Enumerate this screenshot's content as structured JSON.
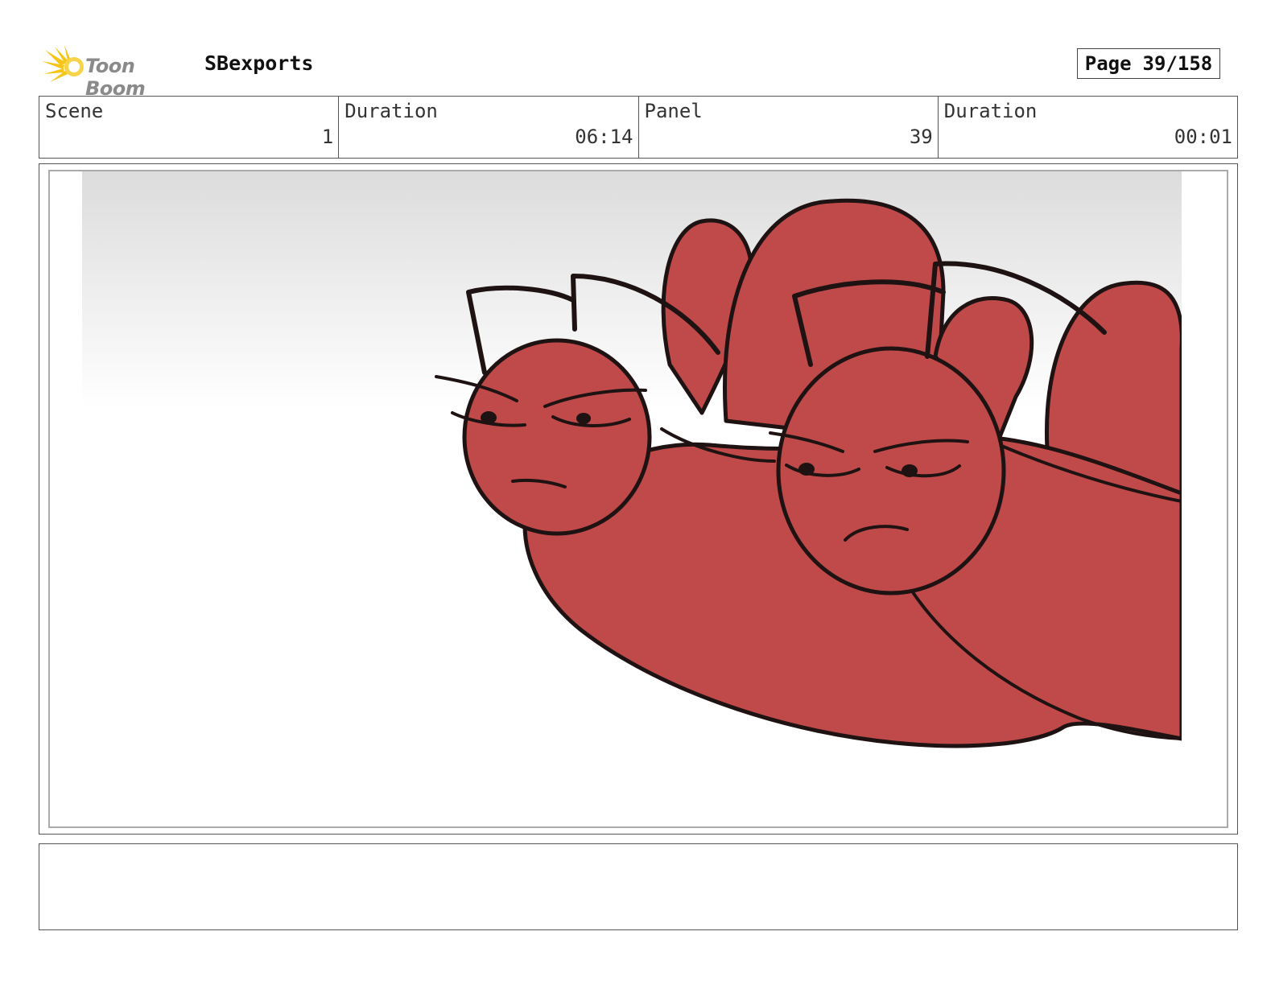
{
  "header": {
    "logo_text": "Toon Boom",
    "project_title": "SBexports",
    "page_label": "Page",
    "page_number": "39/158"
  },
  "info": {
    "scene_label": "Scene",
    "scene_value": "1",
    "scene_duration_label": "Duration",
    "scene_duration_value": "06:14",
    "panel_label": "Panel",
    "panel_value": "39",
    "panel_duration_label": "Duration",
    "panel_duration_value": "00:01"
  },
  "notes": {
    "text": ""
  },
  "colors": {
    "character_fill": "#c04a4a",
    "ink": "#1e1212",
    "logo_accent": "#f5c518"
  }
}
